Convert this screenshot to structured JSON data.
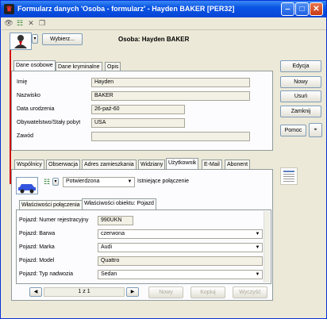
{
  "window": {
    "title": "Formularz danych 'Osoba - formularz' - Hayden BAKER [PER32]"
  },
  "header": {
    "select_button": "Wybierz...",
    "record_label": "Osoba: Hayden BAKER"
  },
  "top_tabs": [
    "Dane osobowe",
    "Dane kryminalne",
    "Opis"
  ],
  "personal": {
    "fields": [
      {
        "label": "Imię",
        "value": "Hayden"
      },
      {
        "label": "Nazwisko",
        "value": "BAKER"
      },
      {
        "label": "Data urodzenia",
        "value": "26-paź-60"
      },
      {
        "label": "Obywatelstwo/Stały pobyt",
        "value": "USA"
      },
      {
        "label": "Zawód",
        "value": ""
      }
    ]
  },
  "side_buttons": {
    "edit": "Edycja",
    "new": "Nowy",
    "delete": "Usuń",
    "close": "Zamknij",
    "help": "Pomoc"
  },
  "relation_tabs": [
    "Wspólnicy",
    "Obserwacja",
    "Adres zamieszkania",
    "Widziany",
    "Użytkownik",
    "E-Mail",
    "Abonent"
  ],
  "relation": {
    "status": "Potwierdzona",
    "note": "Istniejące połączenie"
  },
  "inner_tabs": [
    "Właściwości połączenia",
    "Właściwości obiektu: Pojazd"
  ],
  "vehicle": {
    "fields": [
      {
        "label": "Pojazd: Numer rejestracyjny",
        "value": "990UKN",
        "dropdown": false
      },
      {
        "label": "Pojazd: Barwa",
        "value": "czerwona",
        "dropdown": true
      },
      {
        "label": "Pojazd: Marka",
        "value": "Audi",
        "dropdown": true
      },
      {
        "label": "Pojazd: Model",
        "value": "Quattro",
        "dropdown": false
      },
      {
        "label": "Pojazd: Typ nadwozia",
        "value": "Sedan",
        "dropdown": true
      }
    ]
  },
  "pager": {
    "text": "1 z 1"
  },
  "bottom_buttons": {
    "new": "Nowy",
    "copy": "Kopiuj",
    "send": "Wyczyść"
  },
  "colors": {
    "accent": "#0a54e3",
    "link_line": "#d01010"
  }
}
